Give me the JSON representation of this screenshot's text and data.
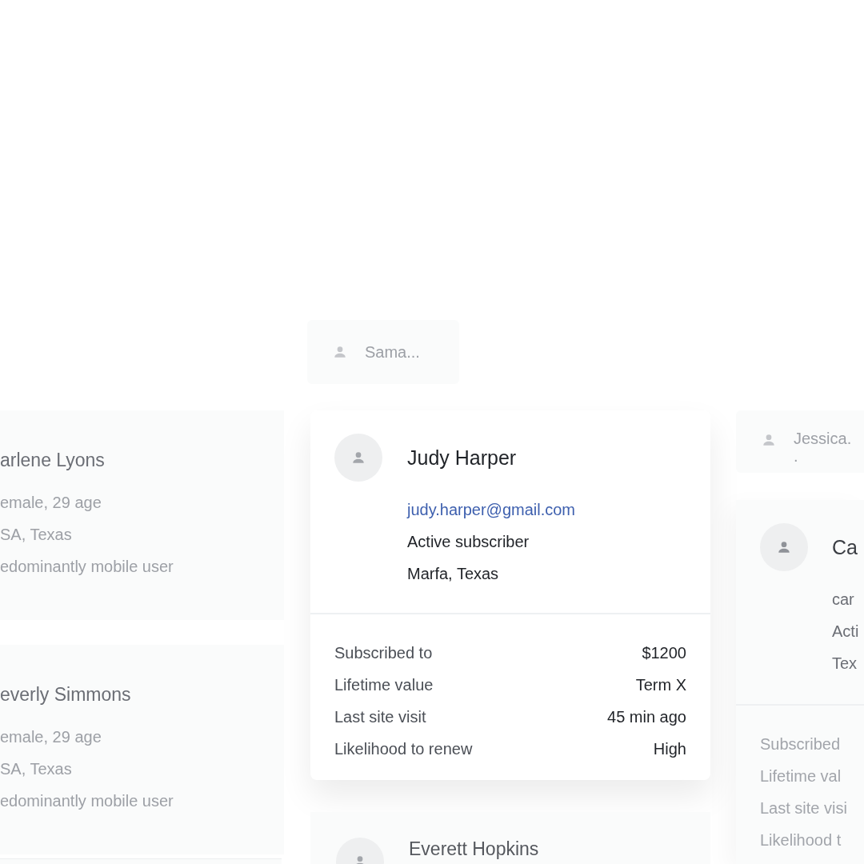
{
  "left_cards": [
    {
      "name": "arlene Lyons",
      "details": [
        "emale, 29 age",
        "SA, Texas",
        "edominantly mobile user"
      ]
    },
    {
      "name": "everly Simmons",
      "details": [
        "emale, 29 age",
        "SA, Texas",
        "edominantly mobile user"
      ]
    }
  ],
  "center_chip": {
    "label": "Sama..."
  },
  "featured_card": {
    "name": "Judy Harper",
    "email": "judy.harper@gmail.com",
    "details": [
      "Active subscriber",
      "Marfa, Texas"
    ],
    "stats": [
      {
        "label": "Subscribed to",
        "value": "$1200"
      },
      {
        "label": "Lifetime value",
        "value": "Term X"
      },
      {
        "label": "Last site visit",
        "value": "45 min ago"
      },
      {
        "label": "Likelihood to renew",
        "value": "High"
      }
    ]
  },
  "next_card": {
    "name": "Everett Hopkins"
  },
  "right_chip": {
    "label_lines": [
      "Jessica.",
      "."
    ]
  },
  "right_card": {
    "name": "Ca",
    "details": [
      "car",
      "Acti",
      "Tex"
    ],
    "stats": [
      "Subscribed",
      "Lifetime val",
      "Last site visi",
      "Likelihood t"
    ]
  }
}
